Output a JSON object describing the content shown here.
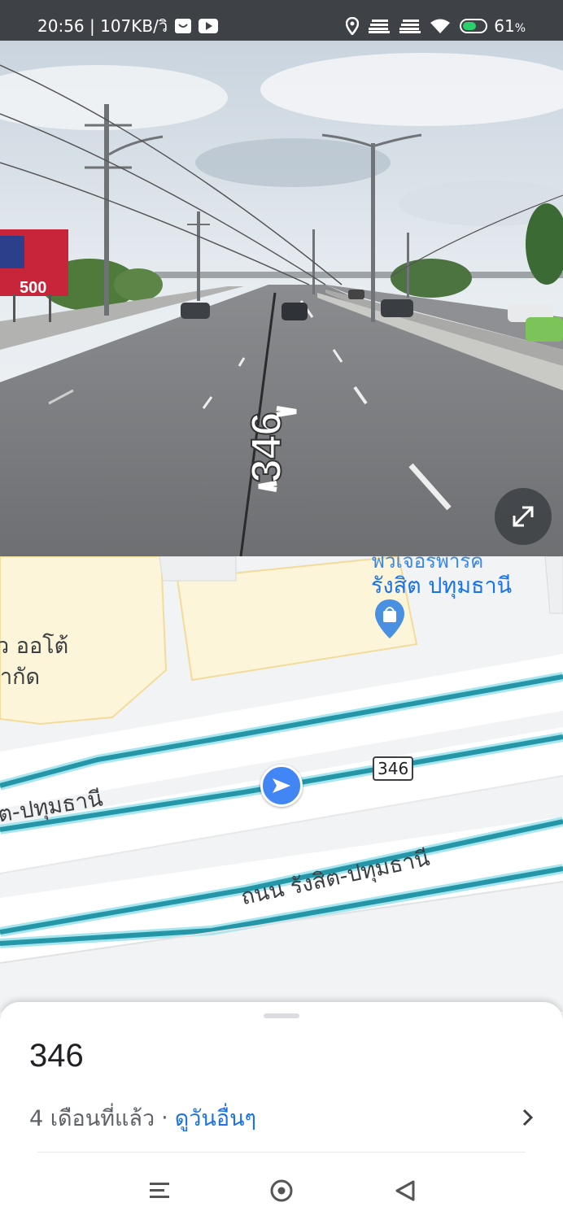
{
  "status_bar": {
    "time_speed": "20:56 | 107KB/วิ",
    "battery": "61",
    "battery_unit": "%",
    "battery_level": 0.61,
    "icons": [
      "face-notification-icon",
      "youtube-icon",
      "location-icon",
      "signal-icon",
      "signal-icon",
      "wifi-icon",
      "battery-icon"
    ]
  },
  "street_view": {
    "road_label": "346",
    "billboard_text": "500",
    "expand_icon": "expand-icon"
  },
  "map": {
    "poi_name": "รังสิต ปทุมธานี",
    "poi_name_top": "ฟิวเจอร์พาร์ค",
    "poi_icon": "shopping-bag-pin-icon",
    "business_label_1": "ว ออโต้",
    "business_label_2": "ากัด",
    "road_label_1": "ต-ปทุมธานี",
    "road_label_2": "ถนน รังสิต-ปทุมธานี",
    "route_shield": "346",
    "location_icon": "navigation-arrow-icon"
  },
  "bottom_sheet": {
    "title": "346",
    "age": "4 เดือนที่แล้ว",
    "separator": "·",
    "see_other_dates": "ดูวันอื่นๆ",
    "chevron_icon": "chevron-right-icon"
  },
  "nav_bar": {
    "icons": [
      "menu-icon",
      "home-icon",
      "back-icon"
    ]
  },
  "colors": {
    "status_bar_bg": "#3e4146",
    "road_cyan": "#2596a8",
    "link_blue": "#1a73e8",
    "marker_blue": "#4285f4",
    "building_yellow": "#fdf5d9"
  }
}
